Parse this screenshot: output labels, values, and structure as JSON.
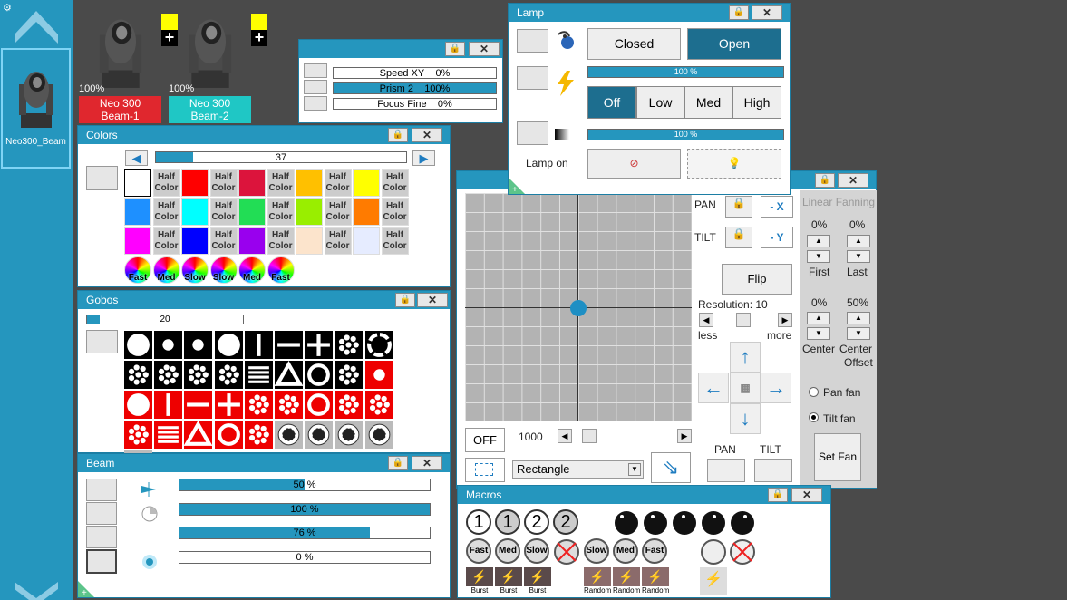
{
  "sidebar": {
    "fixture_label": "Neo300_Beam"
  },
  "fixtures": [
    {
      "name_line1": "Neo 300",
      "name_line2": "Beam-1",
      "pct": "100%",
      "color": "#e0272e"
    },
    {
      "name_line1": "Neo 300",
      "name_line2": "Beam-2",
      "pct": "100%",
      "color": "#1fc7c5"
    }
  ],
  "fine_window": {
    "rows": [
      {
        "label": "Speed XY",
        "value": "0%",
        "fill": 0
      },
      {
        "label": "Prism 2",
        "value": "100%",
        "fill": 1
      },
      {
        "label": "Focus Fine",
        "value": "0%",
        "fill": 0
      }
    ]
  },
  "colors_window": {
    "title": "Colors",
    "slider_value": "37",
    "slider_fill": 0.1,
    "half_label": "Half Color",
    "swatches": [
      [
        "#ffffff",
        "half",
        "#ff0000",
        "half",
        "#dc143c",
        "half",
        "#ffc000",
        "half",
        "#ffff00",
        "half"
      ],
      [
        "#1e90ff",
        "half",
        "#00ffff",
        "half",
        "#22dd55",
        "half",
        "#99ee00",
        "half",
        "#ff7b00",
        "half"
      ],
      [
        "#ff00ff",
        "half",
        "#0000ff",
        "half",
        "#9900ee",
        "half",
        "#fce4cc",
        "half",
        "#e6ecff",
        "half"
      ]
    ],
    "wheel_buttons": [
      "Fast",
      "Med",
      "Slow",
      "Slow",
      "Med",
      "Fast"
    ]
  },
  "gobos_window": {
    "title": "Gobos",
    "slider_value": "20",
    "slider_fill": 0.07
  },
  "beam_window": {
    "title": "Beam",
    "sliders": [
      {
        "value": "50 %",
        "fill": 0.5
      },
      {
        "value": "100 %",
        "fill": 1
      },
      {
        "value": "76 %",
        "fill": 0.76
      },
      {
        "value": "0 %",
        "fill": 0
      }
    ]
  },
  "lamp_window": {
    "title": "Lamp",
    "closed": "Closed",
    "open": "Open",
    "intensity_value": "100 %",
    "modes": [
      "Off",
      "Low",
      "Med",
      "High"
    ],
    "dimmer_value": "100 %",
    "lamp_on": "Lamp on"
  },
  "pantilt_window": {
    "pan": "PAN",
    "tilt": "TILT",
    "neg_x": "- X",
    "neg_y": "- Y",
    "flip": "Flip",
    "resolution": "Resolution: 10",
    "less": "less",
    "more": "more",
    "off": "OFF",
    "speed": "1000",
    "shape": "Rectangle",
    "pan_bottom": "PAN",
    "tilt_bottom": "TILT",
    "fanning_title": "Linear Fanning",
    "first_pct": "0%",
    "last_pct": "0%",
    "first": "First",
    "last": "Last",
    "center_pct": "0%",
    "offset_pct": "50%",
    "center": "Center",
    "center_offset_1": "Center",
    "center_offset_2": "Offset",
    "pan_fan": "Pan fan",
    "tilt_fan": "Tilt fan",
    "set_fan": "Set Fan"
  },
  "macros_window": {
    "title": "Macros",
    "numbers": [
      "1",
      "1",
      "2",
      "2"
    ],
    "speed_buttons": [
      "Fast",
      "Med",
      "Slow"
    ],
    "speed_buttons_2": [
      "Slow",
      "Med",
      "Fast"
    ],
    "burst": [
      "Burst",
      "Burst",
      "Burst"
    ],
    "random": [
      "Random",
      "Random",
      "Random"
    ]
  }
}
